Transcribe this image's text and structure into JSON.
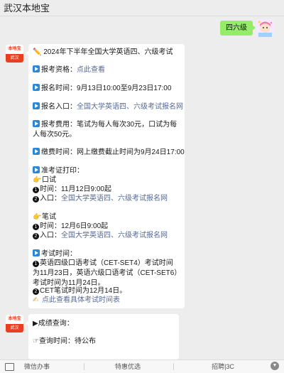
{
  "header": {
    "title": "武汉本地宝"
  },
  "user_message": {
    "text": "四六级"
  },
  "bot_avatar": {
    "top_text": "本地宝",
    "bottom_text": "武汉"
  },
  "message1": {
    "heading_icon": "pencil-icon",
    "heading": "2024年下半年全国大学英语四、六级考试",
    "eligibility": {
      "label": "报考资格：",
      "link": "点此查看"
    },
    "reg_time": {
      "label": "报名时间：",
      "value": "9月13日10:00至9月23日17:00"
    },
    "reg_entry": {
      "label": "报名入口：",
      "link": "全国大学英语四、六级考试报名网"
    },
    "fee": {
      "label": "报考费用：",
      "value": "笔试为每人每次30元，口试为每人每次50元。"
    },
    "pay_time": {
      "label": "缴费时间：",
      "value": "网上缴费截止时间为9月24日17:00"
    },
    "admit": {
      "label": "准考证打印：",
      "oral": {
        "title": "口试",
        "time_label": "时间：",
        "time_value": "11月12日9:00起",
        "entry_label": "入口：",
        "entry_link": "全国大学英语四、六级考试报名网"
      },
      "written": {
        "title": "笔试",
        "time_label": "时间：",
        "time_value": "12月6日9:00起",
        "entry_label": "入口：",
        "entry_link": "全国大学英语四、六级考试报名网"
      }
    },
    "exam_time": {
      "label": "考试时间：",
      "item1": "英语四级口语考试（CET-SET4）考试时间为11月23日，英语六级口语考试（CET-SET6）考试时间为11月24日。",
      "item2": "CET笔试时间为12月14日。",
      "detail_link": "点此查看具体考试时间表"
    }
  },
  "message2": {
    "results_label": "成绩查询：",
    "query_time_label": "查询时间：",
    "query_time_value": "待公布"
  },
  "tabbar": {
    "tab1": "微信办事",
    "tab2": "特惠优选",
    "tab3": "招聘|3C"
  },
  "colors": {
    "user_bubble": "#95ec69",
    "link": "#576b95",
    "background": "#ededed",
    "brand_red": "#e83f22"
  }
}
